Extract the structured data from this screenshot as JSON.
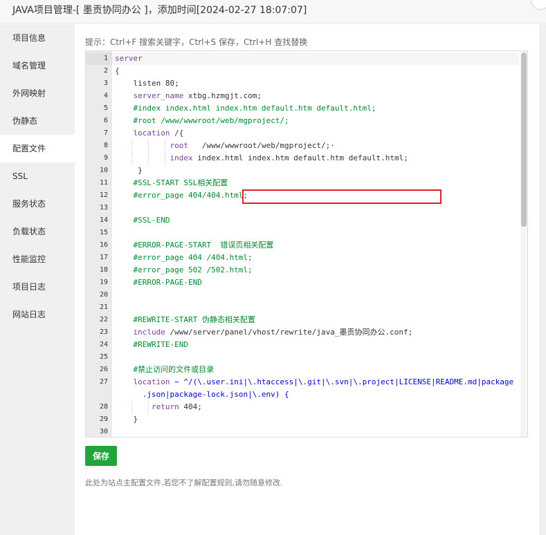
{
  "window": {
    "title": "JAVA项目管理-[ 墨贡协同办公 ]，添加时间[2024-02-27 18:07:07]"
  },
  "sidebar": {
    "items": [
      {
        "label": "项目信息"
      },
      {
        "label": "域名管理"
      },
      {
        "label": "外网映射"
      },
      {
        "label": "伪静态"
      },
      {
        "label": "配置文件",
        "active": true
      },
      {
        "label": "SSL"
      },
      {
        "label": "服务状态"
      },
      {
        "label": "负载状态"
      },
      {
        "label": "性能监控"
      },
      {
        "label": "项目日志"
      },
      {
        "label": "网站日志"
      }
    ]
  },
  "hint": "提示：Ctrl+F 搜索关键字，Ctrl+S 保存，Ctrl+H 查找替换",
  "editor": {
    "lines": [
      {
        "n": "1",
        "tokens": [
          {
            "t": "server",
            "c": "dir"
          }
        ]
      },
      {
        "n": "2",
        "tokens": [
          {
            "t": "{",
            "c": "plain"
          }
        ]
      },
      {
        "n": "3",
        "tokens": [
          {
            "t": "    listen 80;",
            "c": "plain"
          }
        ]
      },
      {
        "n": "4",
        "tokens": [
          {
            "t": "    ",
            "c": "plain"
          },
          {
            "t": "server_name",
            "c": "dir"
          },
          {
            "t": " xtbg.hzmgjt.com;",
            "c": "plain"
          }
        ]
      },
      {
        "n": "5",
        "tokens": [
          {
            "t": "    #index index.html index.htm default.htm default.html;",
            "c": "cmt"
          }
        ]
      },
      {
        "n": "6",
        "tokens": [
          {
            "t": "    #root /www/wwwroot/web/mgproject/;",
            "c": "cmt"
          }
        ]
      },
      {
        "n": "7",
        "tokens": [
          {
            "t": "    ",
            "c": "plain"
          },
          {
            "t": "location",
            "c": "dir"
          },
          {
            "t": " /{",
            "c": "plain"
          }
        ]
      },
      {
        "n": "8",
        "tokens": [
          {
            "t": "            ",
            "c": "plain"
          },
          {
            "t": "root",
            "c": "dir"
          },
          {
            "t": "   /www/wwwroot/web/mgproject/;·",
            "c": "plain"
          }
        ]
      },
      {
        "n": "9",
        "tokens": [
          {
            "t": "            ",
            "c": "plain"
          },
          {
            "t": "index",
            "c": "dir"
          },
          {
            "t": " index.html index.htm default.htm default.html;",
            "c": "plain"
          }
        ]
      },
      {
        "n": "10",
        "tokens": [
          {
            "t": "     }",
            "c": "plain"
          }
        ]
      },
      {
        "n": "11",
        "tokens": [
          {
            "t": "    #SSL-START SSL相关配置",
            "c": "cmt"
          }
        ]
      },
      {
        "n": "12",
        "tokens": [
          {
            "t": "    #error_page 404/404.html;",
            "c": "cmt"
          }
        ]
      },
      {
        "n": "13",
        "tokens": [
          {
            "t": "",
            "c": "plain"
          }
        ]
      },
      {
        "n": "14",
        "tokens": [
          {
            "t": "    #SSL-END",
            "c": "cmt"
          }
        ]
      },
      {
        "n": "15",
        "tokens": [
          {
            "t": "",
            "c": "plain"
          }
        ]
      },
      {
        "n": "16",
        "tokens": [
          {
            "t": "    #ERROR-PAGE-START  错误页相关配置",
            "c": "cmt"
          }
        ]
      },
      {
        "n": "17",
        "tokens": [
          {
            "t": "    #error_page 404 /404.html;",
            "c": "cmt"
          }
        ]
      },
      {
        "n": "18",
        "tokens": [
          {
            "t": "    #error_page 502 /502.html;",
            "c": "cmt"
          }
        ]
      },
      {
        "n": "19",
        "tokens": [
          {
            "t": "    #ERROR-PAGE-END",
            "c": "cmt"
          }
        ]
      },
      {
        "n": "20",
        "tokens": [
          {
            "t": "",
            "c": "plain"
          }
        ]
      },
      {
        "n": "21",
        "tokens": [
          {
            "t": "",
            "c": "plain"
          }
        ]
      },
      {
        "n": "22",
        "tokens": [
          {
            "t": "    #REWRITE-START 伪静态相关配置",
            "c": "cmt"
          }
        ]
      },
      {
        "n": "23",
        "tokens": [
          {
            "t": "    ",
            "c": "plain"
          },
          {
            "t": "include",
            "c": "dir"
          },
          {
            "t": " /www/server/panel/vhost/rewrite/java_墨贡协同办公.conf;",
            "c": "plain"
          }
        ]
      },
      {
        "n": "24",
        "tokens": [
          {
            "t": "    #REWRITE-END",
            "c": "cmt"
          }
        ]
      },
      {
        "n": "25",
        "tokens": [
          {
            "t": "",
            "c": "plain"
          }
        ]
      },
      {
        "n": "26",
        "tokens": [
          {
            "t": "    #禁止访问的文件或目录",
            "c": "cmt"
          }
        ]
      },
      {
        "n": "27",
        "tokens": [
          {
            "t": "    ",
            "c": "plain"
          },
          {
            "t": "location",
            "c": "dir"
          },
          {
            "t": " ~ ^/(\\.user.ini|\\.htaccess|\\.git|\\.svn|\\.project|LICENSE|README.md|package\n      .json|package-lock.json|\\.env) {",
            "c": "kw"
          }
        ],
        "wrap": true
      },
      {
        "n": "28",
        "tokens": [
          {
            "t": "        ",
            "c": "plain"
          },
          {
            "t": "return",
            "c": "dir"
          },
          {
            "t": " 404;",
            "c": "plain"
          }
        ]
      },
      {
        "n": "29",
        "tokens": [
          {
            "t": "    }",
            "c": "plain"
          }
        ]
      },
      {
        "n": "30",
        "tokens": [
          {
            "t": "",
            "c": "plain"
          }
        ]
      }
    ]
  },
  "save_label": "保存",
  "footer_note": "此处为站点主配置文件,若您不了解配置规则,请勿随意修改.",
  "colors": {
    "save_button": "#20a53a",
    "highlight_box": "#e02020",
    "comment": "#008a2e",
    "directive": "#7a3e9d",
    "keyword": "#0000cc"
  }
}
